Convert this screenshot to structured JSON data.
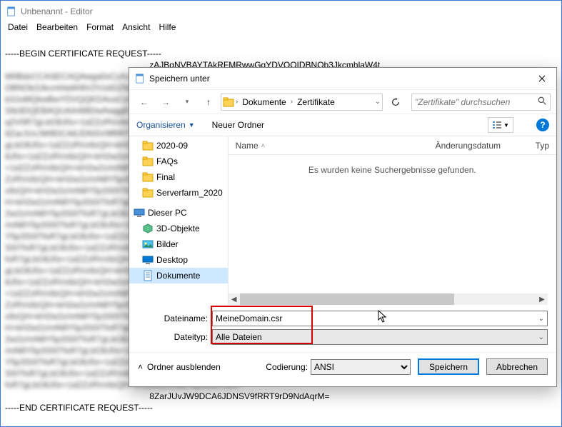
{
  "notepad": {
    "title": "Unbenannt - Editor",
    "menu": [
      "Datei",
      "Bearbeiten",
      "Format",
      "Ansicht",
      "Hilfe"
    ],
    "line_begin": "-----BEGIN CERTIFICATE REQUEST-----",
    "line_sample": "zAJBgNVBAYTAkRFMRwwGgYDVQQIDBNOb3JkcmhlaW4t",
    "line_tail": "8ZarJUvJW9DCA6JDNSV9fRRT9rD9NdAqrM=",
    "line_end": "-----END CERTIFICATE REQUEST-----"
  },
  "dialog": {
    "title": "Speichern unter",
    "breadcrumb": [
      "Dokumente",
      "Zertifikate"
    ],
    "search_placeholder": "\"Zertifikate\" durchsuchen",
    "organize": "Organisieren",
    "new_folder": "Neuer Ordner",
    "tree": {
      "folders": [
        "2020-09",
        "FAQs",
        "Final",
        "Serverfarm_2020"
      ],
      "this_pc": "Dieser PC",
      "pc_children": [
        "3D-Objekte",
        "Bilder",
        "Desktop",
        "Dokumente"
      ]
    },
    "columns": {
      "name": "Name",
      "modified": "Änderungsdatum",
      "type": "Typ"
    },
    "no_results": "Es wurden keine Suchergebnisse gefunden.",
    "filename_label": "Dateiname:",
    "filename_value": "MeineDomain.csr",
    "filetype_label": "Dateityp:",
    "filetype_value": "Alle Dateien",
    "hide_folders": "Ordner ausblenden",
    "encoding_label": "Codierung:",
    "encoding_value": "ANSI",
    "save": "Speichern",
    "cancel": "Abbrechen"
  }
}
